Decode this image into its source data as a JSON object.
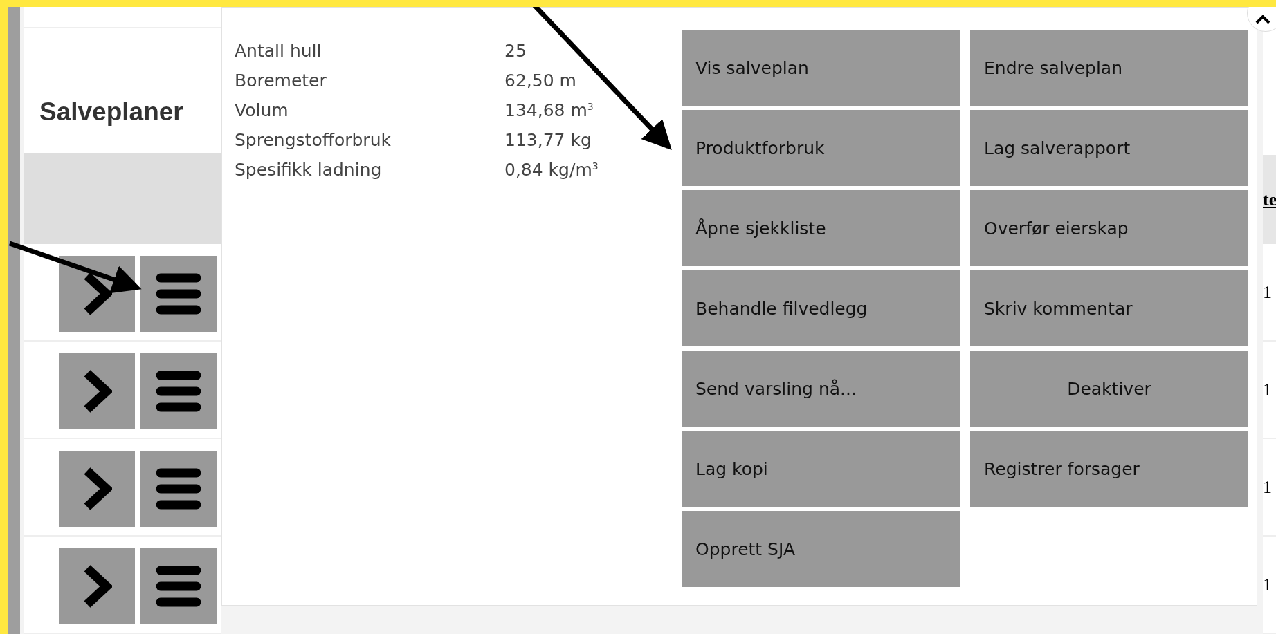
{
  "panel": {
    "title": "Salveplaner",
    "rows": [
      {
        "kind": "plan"
      },
      {
        "kind": "plan"
      },
      {
        "kind": "plan"
      },
      {
        "kind": "plan"
      }
    ]
  },
  "popup": {
    "stats": [
      {
        "label": "Antall hull",
        "value": "25"
      },
      {
        "label": "Boremeter",
        "value": "62,50 m"
      },
      {
        "label": "Volum",
        "value": "134,68 m$^{3}$"
      },
      {
        "label": "Sprengstofforbruk",
        "value": "113,77 kg"
      },
      {
        "label": "Spesifikk ladning",
        "value": "0,84 kg/m$^{3}$"
      }
    ],
    "actions": [
      {
        "label": "Vis salveplan",
        "centered": false
      },
      {
        "label": "Endre salveplan",
        "centered": false
      },
      {
        "label": "Produktforbruk",
        "centered": false
      },
      {
        "label": "Lag salverapport",
        "centered": false
      },
      {
        "label": "Åpne sjekkliste",
        "centered": false
      },
      {
        "label": "Overfør eierskap",
        "centered": false
      },
      {
        "label": "Behandle filvedlegg",
        "centered": false
      },
      {
        "label": "Skriv kommentar",
        "centered": false
      },
      {
        "label": "Send varsling nå...",
        "centered": false
      },
      {
        "label": "Deaktiver",
        "centered": true
      },
      {
        "label": "Lag kopi",
        "centered": false
      },
      {
        "label": "Registrer forsager",
        "centered": false
      },
      {
        "label": "Opprett SJA",
        "centered": false
      }
    ]
  },
  "table": {
    "header": "te",
    "rows": [
      "1",
      "1",
      "1",
      "1"
    ]
  }
}
